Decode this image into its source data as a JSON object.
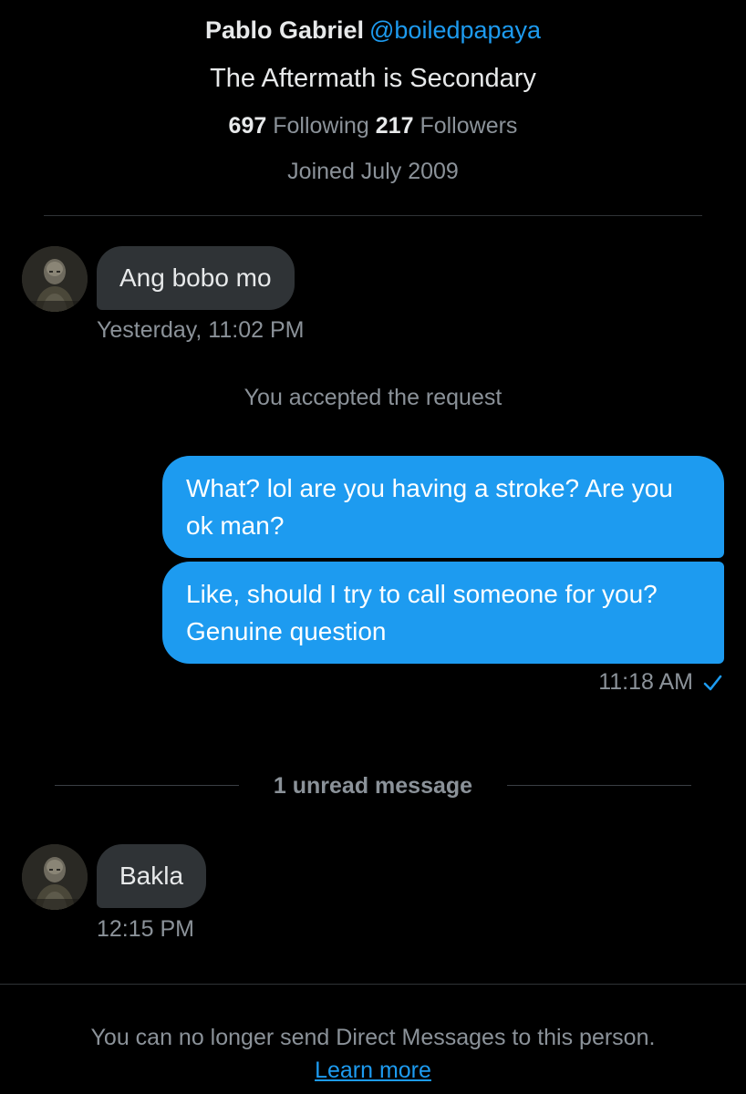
{
  "profile": {
    "display_name": "Pablo Gabriel",
    "handle": "@boiledpapaya",
    "bio": "The Aftermath is Secondary",
    "following_count": "697",
    "following_label": "Following",
    "followers_count": "217",
    "followers_label": "Followers",
    "joined": "Joined July 2009"
  },
  "conversation": {
    "incoming_1": {
      "text": "Ang bobo mo",
      "timestamp": "Yesterday, 11:02 PM",
      "avatar_icon": "user-avatar"
    },
    "system_note": "You accepted the request",
    "outgoing": {
      "messages": [
        "What? lol are you having a stroke? Are you ok man?",
        "Like, should I try to call someone for you? Genuine question"
      ],
      "timestamp": "11:18 AM",
      "status_icon": "check-icon"
    },
    "unread_divider": "1 unread message",
    "incoming_2": {
      "text": "Bakla",
      "timestamp": "12:15 PM",
      "avatar_icon": "user-avatar"
    }
  },
  "footer": {
    "notice": "You can no longer send Direct Messages to this person.",
    "link_label": "Learn more"
  },
  "colors": {
    "background": "#000000",
    "accent": "#1d9bf0",
    "incoming_bubble": "#2f3336",
    "muted_text": "#8b9299",
    "primary_text": "#e7e9ea"
  }
}
